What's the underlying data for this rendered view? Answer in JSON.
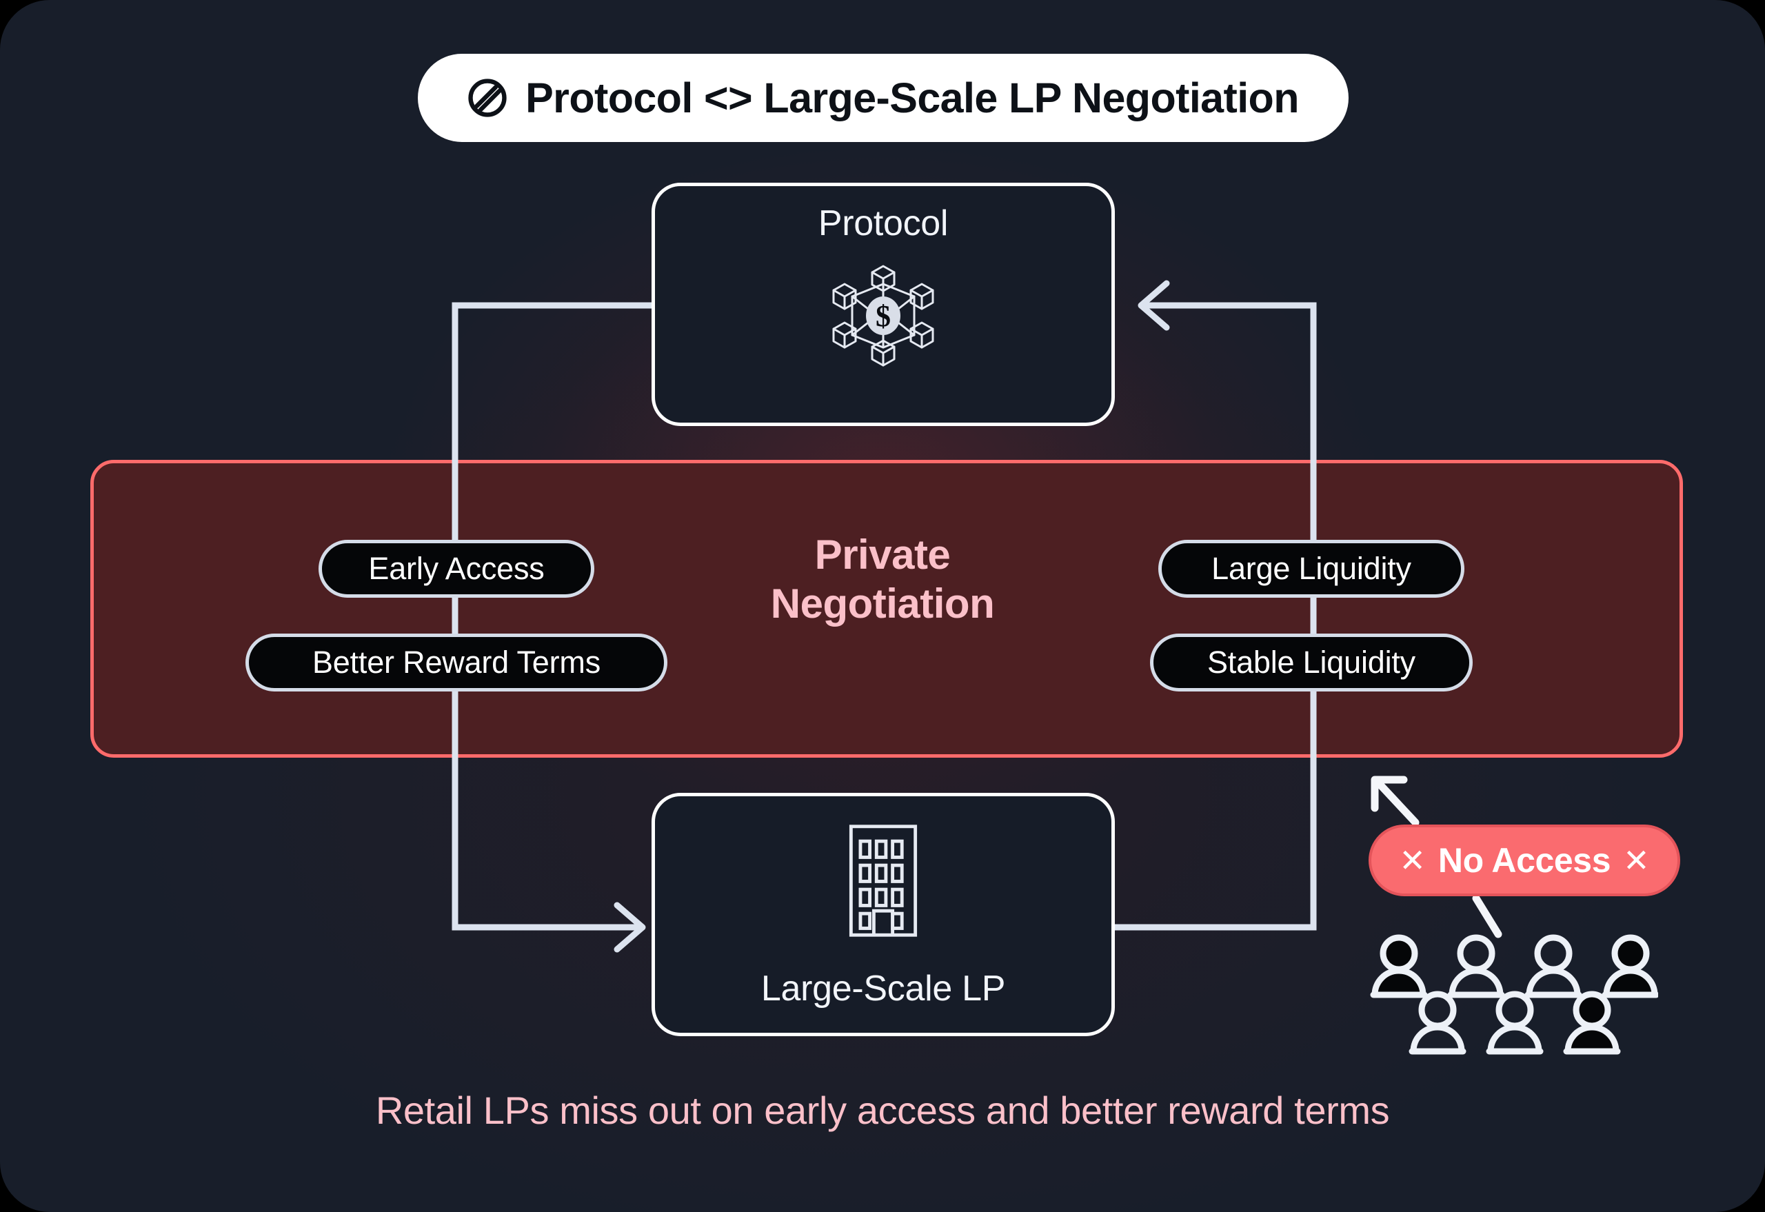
{
  "header": {
    "title": "Protocol <> Large-Scale LP Negotiation",
    "icon": "barred-circle-icon"
  },
  "protocol": {
    "label": "Protocol",
    "icon": "blockchain-network-dollar-icon"
  },
  "large_scale_lp": {
    "label": "Large-Scale LP",
    "icon": "office-building-icon"
  },
  "negotiation": {
    "title_line1": "Private",
    "title_line2": "Negotiation",
    "protocol_side_pills": [
      {
        "label": "Early Access"
      },
      {
        "label": "Better Reward Terms"
      }
    ],
    "lp_side_pills": [
      {
        "label": "Large Liquidity"
      },
      {
        "label": "Stable Liquidity"
      }
    ]
  },
  "retail": {
    "badge_prefix_x": "✕",
    "badge_label": "No Access",
    "badge_suffix_x": "✕",
    "crowd_icon": "people-group-icon",
    "crowd_count": 7
  },
  "caption": {
    "text": "Retail LPs miss out on early access and better reward terms"
  },
  "colors": {
    "canvas_background": "#181E2A",
    "band_fill": "#4D1F22",
    "band_border": "#FF6B6B",
    "accent_pink": "#FBC0C9",
    "badge_red": "#FA6B6F",
    "box_border": "#FFFFFF",
    "pill_fill": "#050608",
    "pill_border": "#D5DCE8"
  }
}
